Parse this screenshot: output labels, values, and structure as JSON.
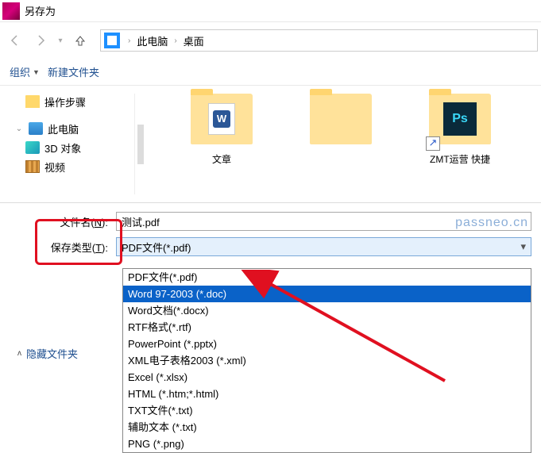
{
  "window": {
    "title": "另存为"
  },
  "breadcrumb": {
    "loc1": "此电脑",
    "loc2": "桌面"
  },
  "toolbar": {
    "organize": "组织",
    "new_folder": "新建文件夹"
  },
  "tree": {
    "folder_steps": "操作步骤",
    "this_pc": "此电脑",
    "d3_objects": "3D 对象",
    "videos": "视频"
  },
  "content": {
    "item1_label": "文章",
    "item3_label": "ZMT运营   快捷"
  },
  "form": {
    "filename_label_pre": "文件名(",
    "filename_label_key": "N",
    "filename_label_post": "):",
    "filename_value": "测试.pdf",
    "savetype_label_pre": "保存类型(",
    "savetype_label_key": "T",
    "savetype_label_post": "):",
    "savetype_value": "PDF文件(*.pdf)"
  },
  "dropdown": [
    "PDF文件(*.pdf)",
    "Word 97-2003 (*.doc)",
    "Word文档(*.docx)",
    "RTF格式(*.rtf)",
    "PowerPoint (*.pptx)",
    "XML电子表格2003 (*.xml)",
    "Excel (*.xlsx)",
    "HTML (*.htm;*.html)",
    "TXT文件(*.txt)",
    "辅助文本 (*.txt)",
    "PNG (*.png)"
  ],
  "dropdown_selected_index": 1,
  "hide_folders": "隐藏文件夹",
  "watermark": "passneo.cn"
}
